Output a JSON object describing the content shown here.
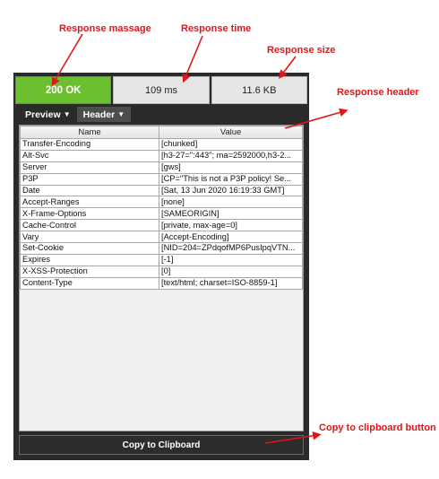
{
  "annotations": {
    "response_message": "Response massage",
    "response_time": "Response time",
    "response_size": "Response size",
    "response_header": "Response header",
    "copy_button": "Copy to clipboard button"
  },
  "status": {
    "message": "200 OK",
    "time": "109 ms",
    "size": "11.6 KB"
  },
  "tabs": {
    "preview_label": "Preview",
    "header_label": "Header"
  },
  "table": {
    "columns": [
      "Name",
      "Value"
    ],
    "rows": [
      [
        "Transfer-Encoding",
        "[chunked]"
      ],
      [
        "Alt-Svc",
        "[h3-27=\":443\"; ma=2592000,h3-2..."
      ],
      [
        "Server",
        "[gws]"
      ],
      [
        "P3P",
        "[CP=\"This is not a P3P policy! Se..."
      ],
      [
        "Date",
        "[Sat, 13 Jun 2020 16:19:33 GMT]"
      ],
      [
        "Accept-Ranges",
        "[none]"
      ],
      [
        "X-Frame-Options",
        "[SAMEORIGIN]"
      ],
      [
        "Cache-Control",
        "[private, max-age=0]"
      ],
      [
        "Vary",
        "[Accept-Encoding]"
      ],
      [
        "Set-Cookie",
        "[NID=204=ZPdqofMP6PusIpqVTN..."
      ],
      [
        "Expires",
        "[-1]"
      ],
      [
        "X-XSS-Protection",
        "[0]"
      ],
      [
        "Content-Type",
        "[text/html; charset=ISO-8859-1]"
      ]
    ]
  },
  "copy_label": "Copy to Clipboard",
  "colors": {
    "annotation": "#e0161b",
    "status_ok": "#6cbf2e",
    "panel": "#2a2a2a"
  }
}
